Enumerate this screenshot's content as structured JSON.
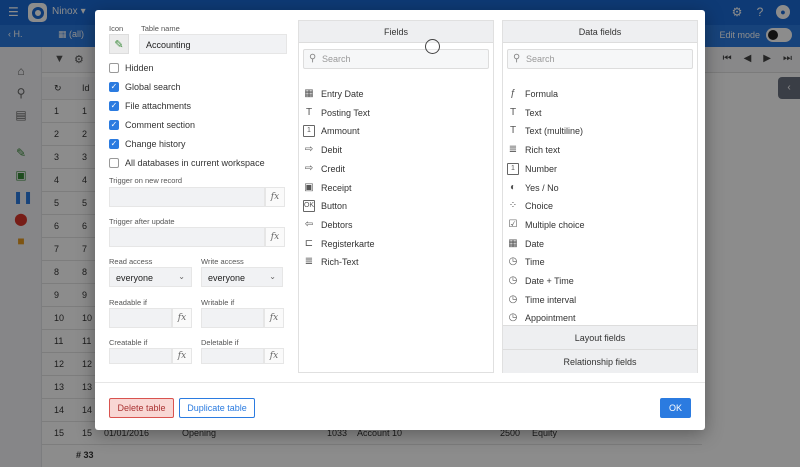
{
  "app": {
    "name": "Ninox"
  },
  "tabbar": {
    "back_label": "H.",
    "tab_all": "(all)",
    "edit_mode": "Edit mode"
  },
  "grid": {
    "rows": [
      {
        "n": "1"
      },
      {
        "n": "2"
      },
      {
        "n": "3"
      },
      {
        "n": "4"
      },
      {
        "n": "5"
      },
      {
        "n": "6"
      },
      {
        "n": "7"
      },
      {
        "n": "8"
      },
      {
        "n": "9"
      },
      {
        "n": "10"
      },
      {
        "n": "11"
      },
      {
        "n": "12"
      },
      {
        "n": "13"
      },
      {
        "n": "14"
      },
      {
        "n": "15",
        "date": "01/01/2016",
        "text": "Opening",
        "amount": "1033",
        "account": "Account 10",
        "value": "2500",
        "type": "Equity"
      }
    ],
    "footer_count": "# 33"
  },
  "dialog": {
    "icon_label": "Icon",
    "table_name_label": "Table name",
    "table_name": "Accounting",
    "checkboxes": [
      {
        "label": "Hidden",
        "checked": false
      },
      {
        "label": "Global search",
        "checked": true
      },
      {
        "label": "File attachments",
        "checked": true
      },
      {
        "label": "Comment section",
        "checked": true
      },
      {
        "label": "Change history",
        "checked": true
      },
      {
        "label": "All databases in current workspace",
        "checked": false
      }
    ],
    "trigger_new_label": "Trigger on new record",
    "trigger_update_label": "Trigger after update",
    "read_access_label": "Read access",
    "read_access_value": "everyone",
    "write_access_label": "Write access",
    "write_access_value": "everyone",
    "readable_if_label": "Readable if",
    "writable_if_label": "Writable if",
    "creatable_if_label": "Creatable if",
    "deletable_if_label": "Deletable if",
    "fx": "fx",
    "fields_panel": {
      "title": "Fields",
      "search_placeholder": "Search",
      "items": [
        {
          "label": "Entry Date",
          "icon": "calendar-icon"
        },
        {
          "label": "Posting Text",
          "icon": "text-icon"
        },
        {
          "label": "Ammount",
          "icon": "number-icon"
        },
        {
          "label": "Debit",
          "icon": "arrow-right-icon"
        },
        {
          "label": "Credit",
          "icon": "arrow-right-icon"
        },
        {
          "label": "Receipt",
          "icon": "image-icon"
        },
        {
          "label": "Button",
          "icon": "button-icon"
        },
        {
          "label": "Debtors",
          "icon": "arrow-left-icon"
        },
        {
          "label": "Registerkarte",
          "icon": "tab-icon"
        },
        {
          "label": "Rich-Text",
          "icon": "rich-text-icon"
        }
      ]
    },
    "datafields_panel": {
      "title": "Data fields",
      "search_placeholder": "Search",
      "items": [
        {
          "label": "Formula",
          "icon": "formula-icon"
        },
        {
          "label": "Text",
          "icon": "text-icon"
        },
        {
          "label": "Text (multiline)",
          "icon": "text-icon"
        },
        {
          "label": "Rich text",
          "icon": "rich-text-icon"
        },
        {
          "label": "Number",
          "icon": "number-icon"
        },
        {
          "label": "Yes / No",
          "icon": "toggle-icon"
        },
        {
          "label": "Choice",
          "icon": "choice-icon"
        },
        {
          "label": "Multiple choice",
          "icon": "checkbox-icon"
        },
        {
          "label": "Date",
          "icon": "calendar-icon"
        },
        {
          "label": "Time",
          "icon": "clock-icon"
        },
        {
          "label": "Date + Time",
          "icon": "calendar-clock-icon"
        },
        {
          "label": "Time interval",
          "icon": "clock-icon"
        },
        {
          "label": "Appointment",
          "icon": "clock-icon"
        }
      ],
      "layout_fields": "Layout fields",
      "relationship_fields": "Relationship fields"
    },
    "delete_button": "Delete table",
    "duplicate_button": "Duplicate table",
    "ok_button": "OK"
  },
  "colors": {
    "accent": "#2b7be0",
    "topbar": "#1a6bd6",
    "danger": "#d9534f"
  }
}
